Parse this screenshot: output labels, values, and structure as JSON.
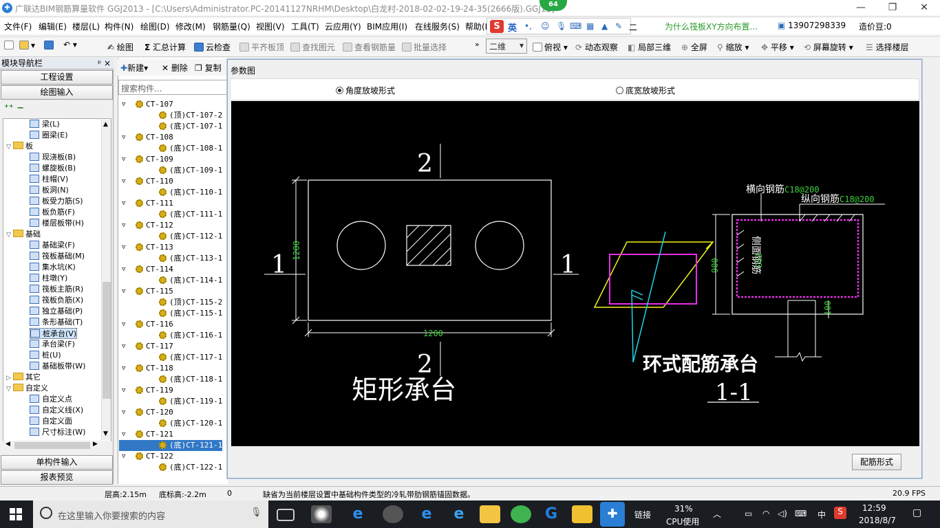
{
  "window": {
    "title": "广联达BIM钢筋算量软件 GGJ2013 - [C:\\Users\\Administrator.PC-20141127NRHM\\Desktop\\白龙村-2018-02-02-19-24-35(2666版).GGJ12]",
    "badge": "64",
    "controls": [
      "—",
      "❐",
      "✕"
    ]
  },
  "menu": [
    "文件(F)",
    "编辑(E)",
    "楼层(L)",
    "构件(N)",
    "绘图(D)",
    "修改(M)",
    "钢筋量(Q)",
    "视图(V)",
    "工具(T)",
    "云应用(Y)",
    "BIM应用(I)",
    "在线服务(S)",
    "帮助(H)"
  ],
  "ime": {
    "logo": "S",
    "lang": "英",
    "extra": "二"
  },
  "question_link": "为什么筏板XY方向布置...",
  "phone": "13907298339",
  "cost_label": "造价豆:0",
  "toolbar": {
    "draw": "绘图",
    "sum": "汇总计算",
    "cloud_check": "云检查",
    "align_slab": "平齐板顶",
    "find_element": "查找图元",
    "view_rebar": "查看钢筋量",
    "batch_select": "批量选择",
    "view_mode": "二维",
    "top_view": "俯视",
    "dynamic_observe": "动态观察",
    "local_3d": "局部三维",
    "fullscreen": "全屏",
    "zoom": "缩放",
    "pan": "平移",
    "rotate": "屏幕旋转",
    "select_floor": "选择楼层"
  },
  "nav": {
    "header": "模块导航栏",
    "pin": "ᵖ ×",
    "project_settings": "工程设置",
    "draw_input": "绘图输入",
    "single_input": "单构件输入",
    "report_preview": "报表预览",
    "tree": [
      {
        "label": "梁(L)",
        "level": 2
      },
      {
        "label": "圈梁(E)",
        "level": 2
      },
      {
        "label": "板",
        "level": 1,
        "folder": true
      },
      {
        "label": "现浇板(B)",
        "level": 2
      },
      {
        "label": "螺旋板(B)",
        "level": 2
      },
      {
        "label": "柱帽(V)",
        "level": 2
      },
      {
        "label": "板洞(N)",
        "level": 2
      },
      {
        "label": "板受力筋(S)",
        "level": 2
      },
      {
        "label": "板负筋(F)",
        "level": 2
      },
      {
        "label": "楼层板带(H)",
        "level": 2
      },
      {
        "label": "基础",
        "level": 1,
        "folder": true
      },
      {
        "label": "基础梁(F)",
        "level": 2
      },
      {
        "label": "筏板基础(M)",
        "level": 2
      },
      {
        "label": "集水坑(K)",
        "level": 2
      },
      {
        "label": "柱墩(Y)",
        "level": 2
      },
      {
        "label": "筏板主筋(R)",
        "level": 2
      },
      {
        "label": "筏板负筋(X)",
        "level": 2
      },
      {
        "label": "独立基础(P)",
        "level": 2
      },
      {
        "label": "条形基础(T)",
        "level": 2
      },
      {
        "label": "桩承台(V)",
        "level": 2,
        "selected": true
      },
      {
        "label": "承台梁(F)",
        "level": 2
      },
      {
        "label": "桩(U)",
        "level": 2
      },
      {
        "label": "基础板带(W)",
        "level": 2
      },
      {
        "label": "其它",
        "level": 1,
        "folder": true,
        "collapsed": true
      },
      {
        "label": "自定义",
        "level": 1,
        "folder": true
      },
      {
        "label": "自定义点",
        "level": 2
      },
      {
        "label": "自定义线(X)",
        "level": 2
      },
      {
        "label": "自定义面",
        "level": 2
      },
      {
        "label": "尺寸标注(W)",
        "level": 2
      }
    ]
  },
  "complist": {
    "new": "新建",
    "delete": "删除",
    "copy": "复制",
    "search_placeholder": "搜索构件...",
    "items": [
      {
        "label": "CT-107",
        "level": 1
      },
      {
        "label": "(顶)CT-107-2",
        "level": 2
      },
      {
        "label": "(底)CT-107-1",
        "level": 2
      },
      {
        "label": "CT-108",
        "level": 1
      },
      {
        "label": "(底)CT-108-1",
        "level": 2
      },
      {
        "label": "CT-109",
        "level": 1
      },
      {
        "label": "(底)CT-109-1",
        "level": 2
      },
      {
        "label": "CT-110",
        "level": 1
      },
      {
        "label": "(底)CT-110-1",
        "level": 2
      },
      {
        "label": "CT-111",
        "level": 1
      },
      {
        "label": "(底)CT-111-1",
        "level": 2
      },
      {
        "label": "CT-112",
        "level": 1
      },
      {
        "label": "(底)CT-112-1",
        "level": 2
      },
      {
        "label": "CT-113",
        "level": 1
      },
      {
        "label": "(底)CT-113-1",
        "level": 2
      },
      {
        "label": "CT-114",
        "level": 1
      },
      {
        "label": "(底)CT-114-1",
        "level": 2
      },
      {
        "label": "CT-115",
        "level": 1
      },
      {
        "label": "(顶)CT-115-2",
        "level": 2
      },
      {
        "label": "(底)CT-115-1",
        "level": 2
      },
      {
        "label": "CT-116",
        "level": 1
      },
      {
        "label": "(底)CT-116-1",
        "level": 2
      },
      {
        "label": "CT-117",
        "level": 1
      },
      {
        "label": "(底)CT-117-1",
        "level": 2
      },
      {
        "label": "CT-118",
        "level": 1
      },
      {
        "label": "(底)CT-118-1",
        "level": 2
      },
      {
        "label": "CT-119",
        "level": 1
      },
      {
        "label": "(底)CT-119-1",
        "level": 2
      },
      {
        "label": "CT-120",
        "level": 1
      },
      {
        "label": "(底)CT-120-1",
        "level": 2
      },
      {
        "label": "CT-121",
        "level": 1
      },
      {
        "label": "(底)CT-121-1",
        "level": 2,
        "selected": true
      },
      {
        "label": "CT-122",
        "level": 1
      },
      {
        "label": "(底)CT-122-1",
        "level": 2
      }
    ]
  },
  "dialog": {
    "title": "参数图",
    "radio_angle": "角度放坡形式",
    "radio_width": "底宽放坡形式",
    "button": "配筋形式",
    "drawing": {
      "sec2_top": "2",
      "sec2_bottom": "2",
      "sec1_left": "1",
      "sec1_right": "1",
      "dim_height": "1200",
      "dim_width": "1200",
      "rect_cap_label": "矩形承台",
      "ring_cap_label": "环式配筋承台",
      "section_label": "1-1",
      "transverse_label": "横向钢筋",
      "transverse_value": "C18@200",
      "longitudinal_label": "纵向钢筋",
      "longitudinal_value": "C18@200",
      "side_label": "侧面钢筋",
      "side_value": "CGJ",
      "dim_900": "900",
      "dim_100": "100"
    }
  },
  "status": {
    "floor_height": "层高:2.15m",
    "base_elev": "底标高:-2.2m",
    "zero": "0",
    "message": "缺省为当前楼层设置中基础构件类型的冷轧带肋钢筋锚固数据。",
    "fps": "20.9 FPS"
  },
  "taskbar": {
    "search_placeholder": "在这里输入你要搜索的内容",
    "link": "链接",
    "cpu_pct": "31%",
    "cpu_label": "CPU使用",
    "ime_lang": "中",
    "time": "12:59",
    "date": "2018/8/7"
  },
  "colors": {
    "canvas_bg": "#000000",
    "cad_white": "#ffffff",
    "cad_green": "#3fd13f",
    "cad_magenta": "#e62ee6",
    "cad_yellow": "#f2f21e",
    "cad_cyan": "#1ed6e6",
    "selection_blue": "#3178c6"
  }
}
